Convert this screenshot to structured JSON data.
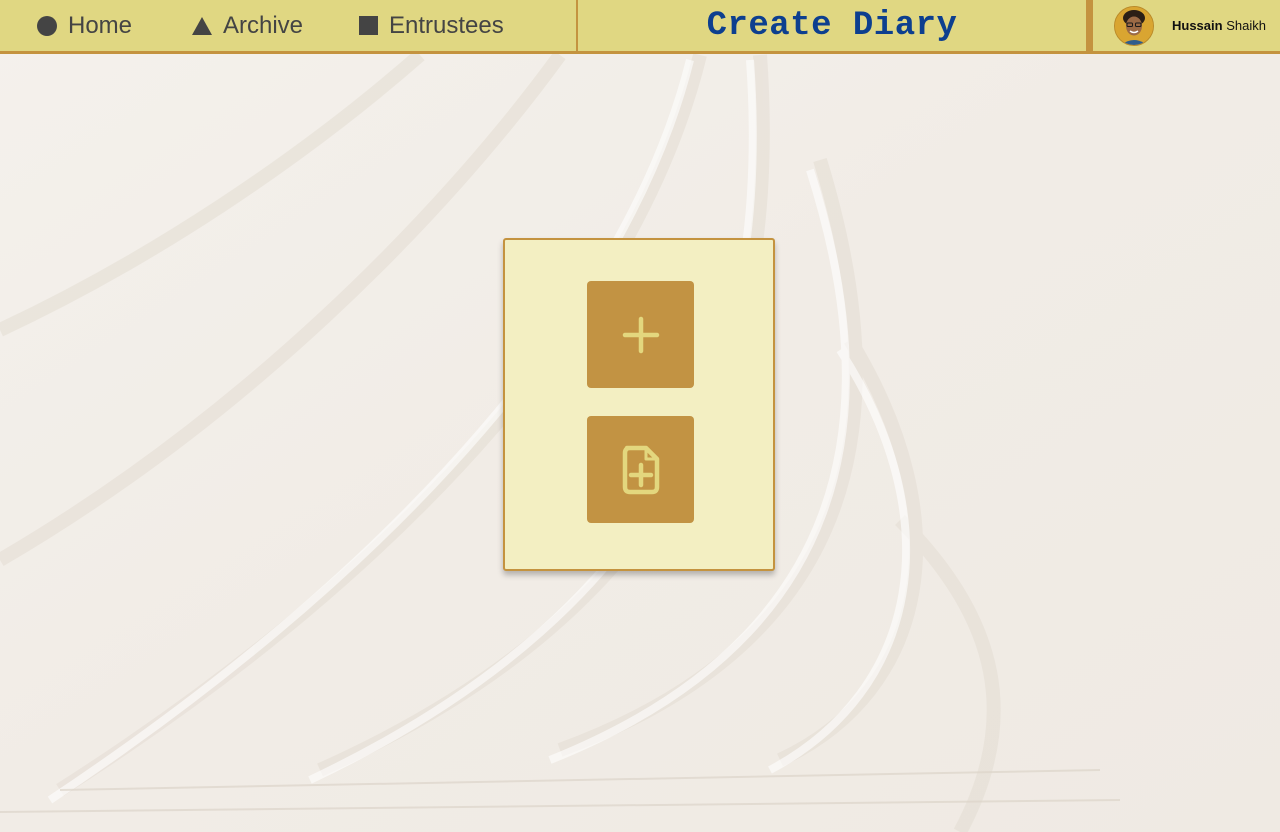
{
  "nav": {
    "items": [
      {
        "label": "Home",
        "icon": "circle-icon"
      },
      {
        "label": "Archive",
        "icon": "triangle-icon"
      },
      {
        "label": "Entrustees",
        "icon": "square-icon"
      }
    ]
  },
  "header": {
    "title": "Create Diary"
  },
  "user": {
    "first_name": "Hussain",
    "last_name": "Shaikh",
    "avatar_icon": "avatar-photo"
  },
  "actions": {
    "add_icon": "plus-icon",
    "new_file_icon": "file-plus-icon"
  },
  "colors": {
    "navbar": "#e0d782",
    "accent": "#c4933f",
    "title": "#0d3f8f",
    "panel": "#f3efc2",
    "button": "#c29343",
    "button_icon": "#e3d77e"
  }
}
